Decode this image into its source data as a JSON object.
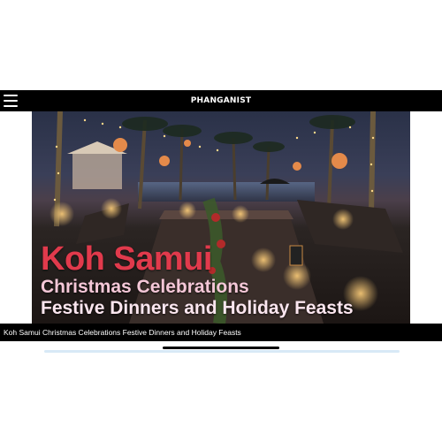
{
  "header": {
    "logo_text": "PHANGANIST",
    "menu_icon": "hamburger-menu-icon",
    "background": "#000000"
  },
  "hero": {
    "headline_line1": "Koh Samui",
    "headline_line2": "Christmas Celebrations",
    "headline_line3": "Festive Dinners and Holiday Feasts",
    "headline_color": "#e13a4c"
  },
  "caption": {
    "text": "Koh Samui Christmas Celebrations Festive Dinners and Holiday Feasts"
  },
  "progress": {
    "color": "#d8e9f6"
  }
}
